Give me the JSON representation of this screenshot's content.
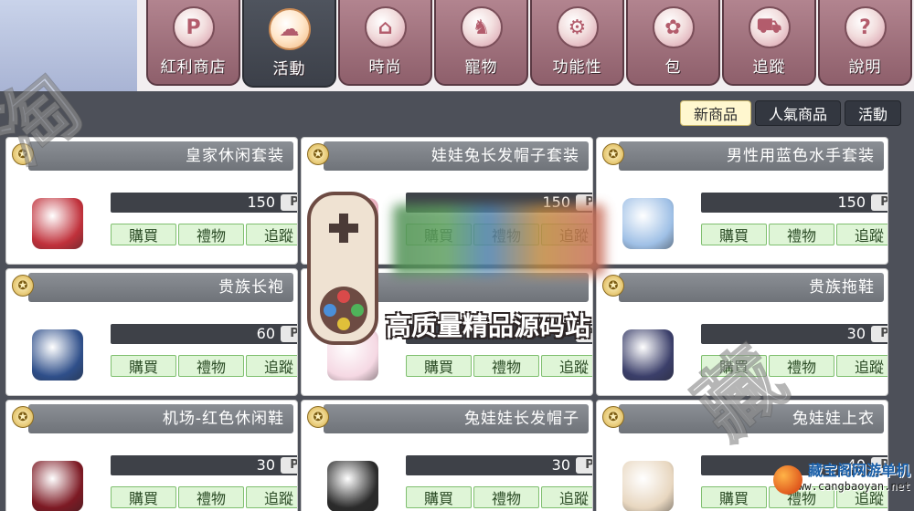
{
  "tabs": [
    {
      "label": "紅利商店",
      "icon": "p-coin-icon",
      "glyph": "P",
      "active": false
    },
    {
      "label": "活動",
      "icon": "cloud-icon",
      "glyph": "☁",
      "active": true
    },
    {
      "label": "時尚",
      "icon": "hanger-icon",
      "glyph": "⌂",
      "active": false
    },
    {
      "label": "寵物",
      "icon": "pet-icon",
      "glyph": "♞",
      "active": false
    },
    {
      "label": "功能性",
      "icon": "gear-icon",
      "glyph": "⚙",
      "active": false
    },
    {
      "label": "包",
      "icon": "bow-icon",
      "glyph": "✿",
      "active": false
    },
    {
      "label": "追蹤",
      "icon": "cart-icon",
      "glyph": "⛟",
      "active": false
    },
    {
      "label": "說明",
      "icon": "lightbulb-icon",
      "glyph": "?",
      "active": false
    }
  ],
  "subtabs": [
    {
      "label": "新商品",
      "active": true
    },
    {
      "label": "人氣商品",
      "active": false
    },
    {
      "label": "活動",
      "active": false
    }
  ],
  "buttons": {
    "buy": "購買",
    "gift": "禮物",
    "track": "追蹤"
  },
  "currency_label": "P",
  "items": [
    {
      "name": "皇家休闲套装",
      "price": "150",
      "sprite_color": "#c0313b"
    },
    {
      "name": "娃娃兔长发帽子套装",
      "price": "150",
      "sprite_color": "#f1b7c6"
    },
    {
      "name": "男性用蓝色水手套装",
      "price": "150",
      "sprite_color": "#9fc0e6"
    },
    {
      "name": "贵族长袍",
      "price": "60",
      "sprite_color": "#2f4f8a"
    },
    {
      "name": "",
      "price": "",
      "sprite_color": "#f5d8e3"
    },
    {
      "name": "贵族拖鞋",
      "price": "30",
      "sprite_color": "#3b3f6a"
    },
    {
      "name": "机场-红色休闲鞋",
      "price": "30",
      "sprite_color": "#7d1a24"
    },
    {
      "name": "兔娃娃长发帽子",
      "price": "30",
      "sprite_color": "#2b2b2b"
    },
    {
      "name": "兔娃娃上衣",
      "price": "40",
      "sprite_color": "#e8d7c0"
    }
  ],
  "watermark": {
    "center_text": "高质量精品源码站",
    "corner_title": "藏宝阁网游单机",
    "corner_url": "www.cangbaoyan.net"
  },
  "colors": {
    "tab_inactive": "#9d6e7a",
    "tab_active": "#454a54",
    "panel": "#4d5059",
    "button_green": "#dff5d7"
  }
}
